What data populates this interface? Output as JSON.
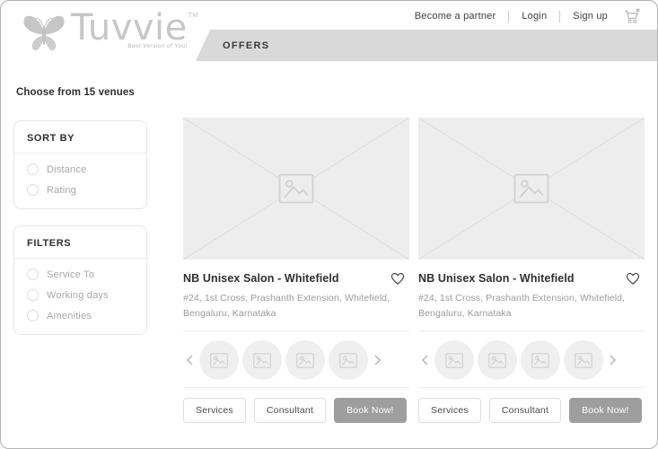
{
  "brand": {
    "name": "Tuvvie",
    "trademark": "TM",
    "tagline": "Best Version of You!"
  },
  "header": {
    "nav": [
      {
        "label": "Become a partner"
      },
      {
        "label": "Login"
      },
      {
        "label": "Sign up"
      }
    ],
    "cart_icon": "shopping-cart with notification dot"
  },
  "offers_tab": {
    "label": "OFFERS"
  },
  "results_summary": {
    "text": "Choose from 15 venues"
  },
  "sidebar": {
    "sort_by": {
      "title": "SORT BY",
      "options": [
        {
          "label": "Distance",
          "selected": false
        },
        {
          "label": "Rating",
          "selected": false
        }
      ]
    },
    "filters": {
      "title": "FILTERS",
      "options": [
        {
          "label": "Service To",
          "selected": false
        },
        {
          "label": "Working days",
          "selected": false
        },
        {
          "label": "Amenities",
          "selected": false
        }
      ]
    }
  },
  "venues": [
    {
      "name": "NB Unisex Salon - Whitefield",
      "address_line1": "#24, 1st Cross, Prashanth Extension, Whitefield,",
      "address_line2": "Bengaluru, Karnataka",
      "thumbnail_count": 4,
      "actions": {
        "services": "Services",
        "consultant": "Consultant",
        "book_now": "Book Now!"
      }
    },
    {
      "name": "NB Unisex Salon - Whitefield",
      "address_line1": "#24, 1st Cross, Prashanth Extension, Whitefield,",
      "address_line2": "Bengaluru, Karnataka",
      "thumbnail_count": 4,
      "actions": {
        "services": "Services",
        "consultant": "Consultant",
        "book_now": "Book Now!"
      }
    }
  ],
  "colors": {
    "tab_bar_bg": "#d9d9d9",
    "logo_gray": "#c7c7c7",
    "placeholder_bg": "#ededed",
    "placeholder_line": "#dcdcdc",
    "book_now_bg": "#9e9e9e",
    "muted_text": "#a8a8a8",
    "dark_text": "#2f2f2f",
    "panel_border": "#e7e7e7",
    "page_border": "#b3b3b3"
  }
}
